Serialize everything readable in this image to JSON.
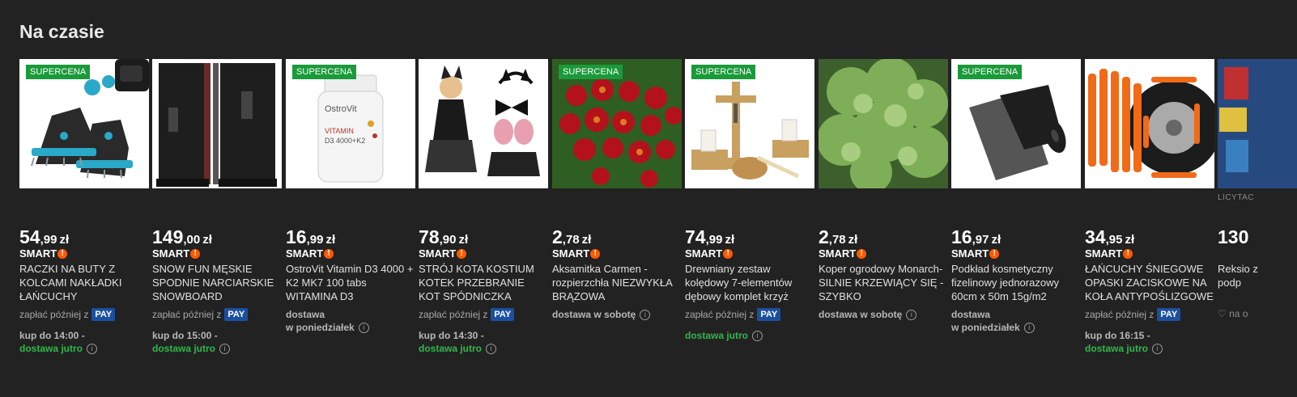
{
  "section": {
    "title": "Na czasie"
  },
  "smart_label": "SMART",
  "pay_prefix": "zapłać później z",
  "pay_label": "PAY",
  "colors": {
    "badge": "#1a9a3a",
    "pay": "#1b4fa0",
    "smart": "#ff5a00",
    "delivery_green": "#2fb84a",
    "background": "#222222"
  },
  "products": [
    {
      "badge": "SUPERCENA",
      "price_int": "54",
      "price_frac": ",99",
      "currency": "zł",
      "title": "RACZKI NA BUTY Z KOLCAMI NAKŁADKI ŁAŃCUCHY TURYSTYCZNE",
      "pay_later": true,
      "delivery_line1": "kup do 14:00 -",
      "delivery_line2": "dostawa jutro",
      "image": "crampons-icon"
    },
    {
      "badge": "",
      "price_int": "149",
      "price_frac": ",00",
      "currency": "zł",
      "title": "SNOW FUN MĘSKIE SPODNIE NARCIARSKIE SNOWBOARD MEMBRANA",
      "pay_later": true,
      "delivery_line1": "kup do 15:00 -",
      "delivery_line2": "dostawa jutro",
      "image": "ski-pants-icon"
    },
    {
      "badge": "SUPERCENA",
      "price_int": "16",
      "price_frac": ",99",
      "currency": "zł",
      "title": "OstroVit Vitamin D3 4000 + K2 MK7 100 tabs WITAMINA D3",
      "pay_later": false,
      "delivery_line1": "dostawa",
      "delivery_line2": "w poniedziałek",
      "image": "vitamin-bottle-icon"
    },
    {
      "badge": "",
      "price_int": "78",
      "price_frac": ",90",
      "currency": "zł",
      "title": "STRÓJ KOTA KOSTIUM KOTEK PRZEBRANIE KOT SPÓDNICZKA STROJE",
      "pay_later": true,
      "delivery_line1": "kup do 14:30 -",
      "delivery_line2": "dostawa jutro",
      "image": "cat-costume-icon"
    },
    {
      "badge": "SUPERCENA",
      "price_int": "2",
      "price_frac": ",78",
      "currency": "zł",
      "title": "Aksamitka Carmen - rozpierzchła NIEZWYKŁA BRĄZOWA",
      "pay_later": false,
      "delivery_line1": "dostawa w sobotę",
      "delivery_line2": "",
      "image": "marigold-flowers-icon"
    },
    {
      "badge": "SUPERCENA",
      "price_int": "74",
      "price_frac": ",99",
      "currency": "zł",
      "title": "Drewniany zestaw kolędowy 7-elementów dębowy komplet krzyż",
      "pay_later": true,
      "delivery_line1": "dostawa jutro",
      "delivery_line2": "",
      "image": "wooden-cross-set-icon"
    },
    {
      "badge": "",
      "price_int": "2",
      "price_frac": ",78",
      "currency": "zł",
      "title": "Koper ogrodowy Monarch- SILNIE KRZEWIĄCY SIĘ - SZYBKO",
      "pay_later": false,
      "delivery_line1": "dostawa w sobotę",
      "delivery_line2": "",
      "image": "dill-plant-icon"
    },
    {
      "badge": "SUPERCENA",
      "price_int": "16",
      "price_frac": ",97",
      "currency": "zł",
      "title": "Podkład kosmetyczny fizelinowy jednorazowy 60cm x 50m 15g/m2",
      "pay_later": false,
      "delivery_line1": "dostawa",
      "delivery_line2": "w poniedziałek",
      "image": "fleece-roll-icon"
    },
    {
      "badge": "",
      "price_int": "34",
      "price_frac": ",95",
      "currency": "zł",
      "title": "ŁAŃCUCHY ŚNIEGOWE OPASKI ZACISKOWE NA KOŁA ANTYPOŚLIZGOWE",
      "pay_later": true,
      "delivery_line1": "kup do 16:15 -",
      "delivery_line2": "dostawa jutro",
      "image": "snow-chains-icon"
    },
    {
      "badge": "",
      "price_int": "130",
      "price_frac": "",
      "currency": "",
      "title": "Reksio z podp",
      "auction": "LICYTAC",
      "wishlist": "na o",
      "image": "partial-product-icon"
    }
  ]
}
